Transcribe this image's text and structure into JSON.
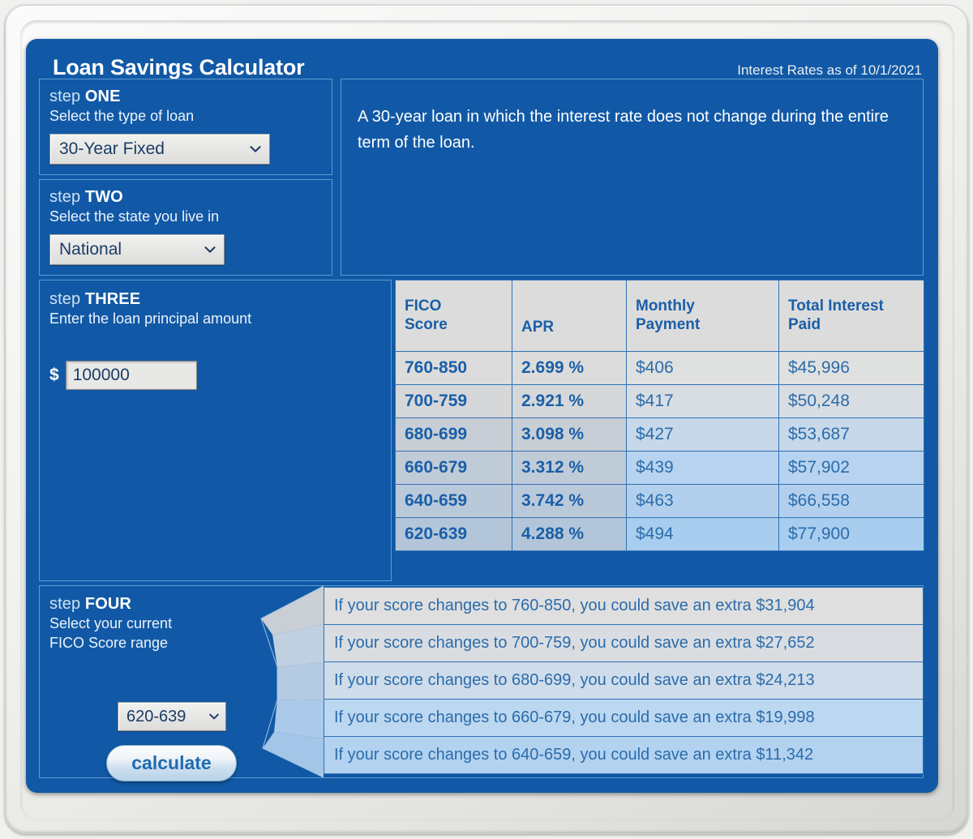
{
  "header": {
    "title": "Loan Savings Calculator",
    "rates_date": "Interest Rates as of 10/1/2021"
  },
  "step_one": {
    "step_word": "step",
    "step_number": "ONE",
    "description": "Select the type of loan",
    "selected": "30-Year Fixed",
    "chevron": "chevron-down-icon"
  },
  "step_two": {
    "step_word": "step",
    "step_number": "TWO",
    "description": "Select the state you live in",
    "selected": "National",
    "chevron": "chevron-down-icon"
  },
  "step_three": {
    "step_word": "step",
    "step_number": "THREE",
    "description": "Enter the loan principal amount",
    "currency_symbol": "$",
    "principal_value": "100000"
  },
  "step_four": {
    "step_word": "step",
    "step_number": "FOUR",
    "description_line1": "Select your current",
    "description_line2": "FICO Score range",
    "selected": "620-639",
    "chevron": "chevron-down-icon",
    "calculate_label": "calculate"
  },
  "loan_description": "A 30-year loan in which the interest rate does not change during the entire term of the loan.",
  "rates_table": {
    "headers": [
      "FICO Score",
      "APR",
      "Monthly Payment",
      "Total Interest Paid"
    ],
    "header_lines": [
      [
        "FICO",
        "Score"
      ],
      [
        "APR",
        ""
      ],
      [
        "Monthly",
        "Payment"
      ],
      [
        "Total Interest",
        "Paid"
      ]
    ],
    "rows": [
      {
        "fico": "760-850",
        "apr": "2.699 %",
        "monthly": "$406",
        "total_interest": "$45,996",
        "bg_key": "#dcdcdc",
        "bg_val": "#dfe0e0"
      },
      {
        "fico": "700-759",
        "apr": "2.921 %",
        "monthly": "$417",
        "total_interest": "$50,248",
        "bg_key": "#d5d7d9",
        "bg_val": "#d8dde3"
      },
      {
        "fico": "680-699",
        "apr": "3.098 %",
        "monthly": "$427",
        "total_interest": "$53,687",
        "bg_key": "#c8ced6",
        "bg_val": "#c6d8ea"
      },
      {
        "fico": "660-679",
        "apr": "3.312 %",
        "monthly": "$439",
        "total_interest": "$57,902",
        "bg_key": "#c0cbd8",
        "bg_val": "#b7d3ef"
      },
      {
        "fico": "640-659",
        "apr": "3.742 %",
        "monthly": "$463",
        "total_interest": "$66,558",
        "bg_key": "#b9c9da",
        "bg_val": "#b2d0ed"
      },
      {
        "fico": "620-639",
        "apr": "4.288 %",
        "monthly": "$494",
        "total_interest": "$77,900",
        "bg_key": "#b3c6d9",
        "bg_val": "#a8cdee"
      }
    ]
  },
  "savings": [
    {
      "text": "If your score changes to 760-850, you could save an extra $31,904",
      "bg": "#dfdfdf"
    },
    {
      "text": "If your score changes to 700-759, you could save an extra $27,652",
      "bg": "#d9dde2"
    },
    {
      "text": "If your score changes to 680-699, you could save an extra $24,213",
      "bg": "#cfdcea"
    },
    {
      "text": "If your score changes to 660-679, you could save an extra $19,998",
      "bg": "#bcd7f0"
    },
    {
      "text": "If your score changes to 640-659, you could save an extra $11,342",
      "bg": "#b2d2f0"
    }
  ],
  "colors": {
    "panel_blue": "#1159a6",
    "panel_border": "#5e9bd0",
    "table_border": "#2f72b4",
    "header_text": "#1a5fa8",
    "value_text": "#2b6cab"
  }
}
